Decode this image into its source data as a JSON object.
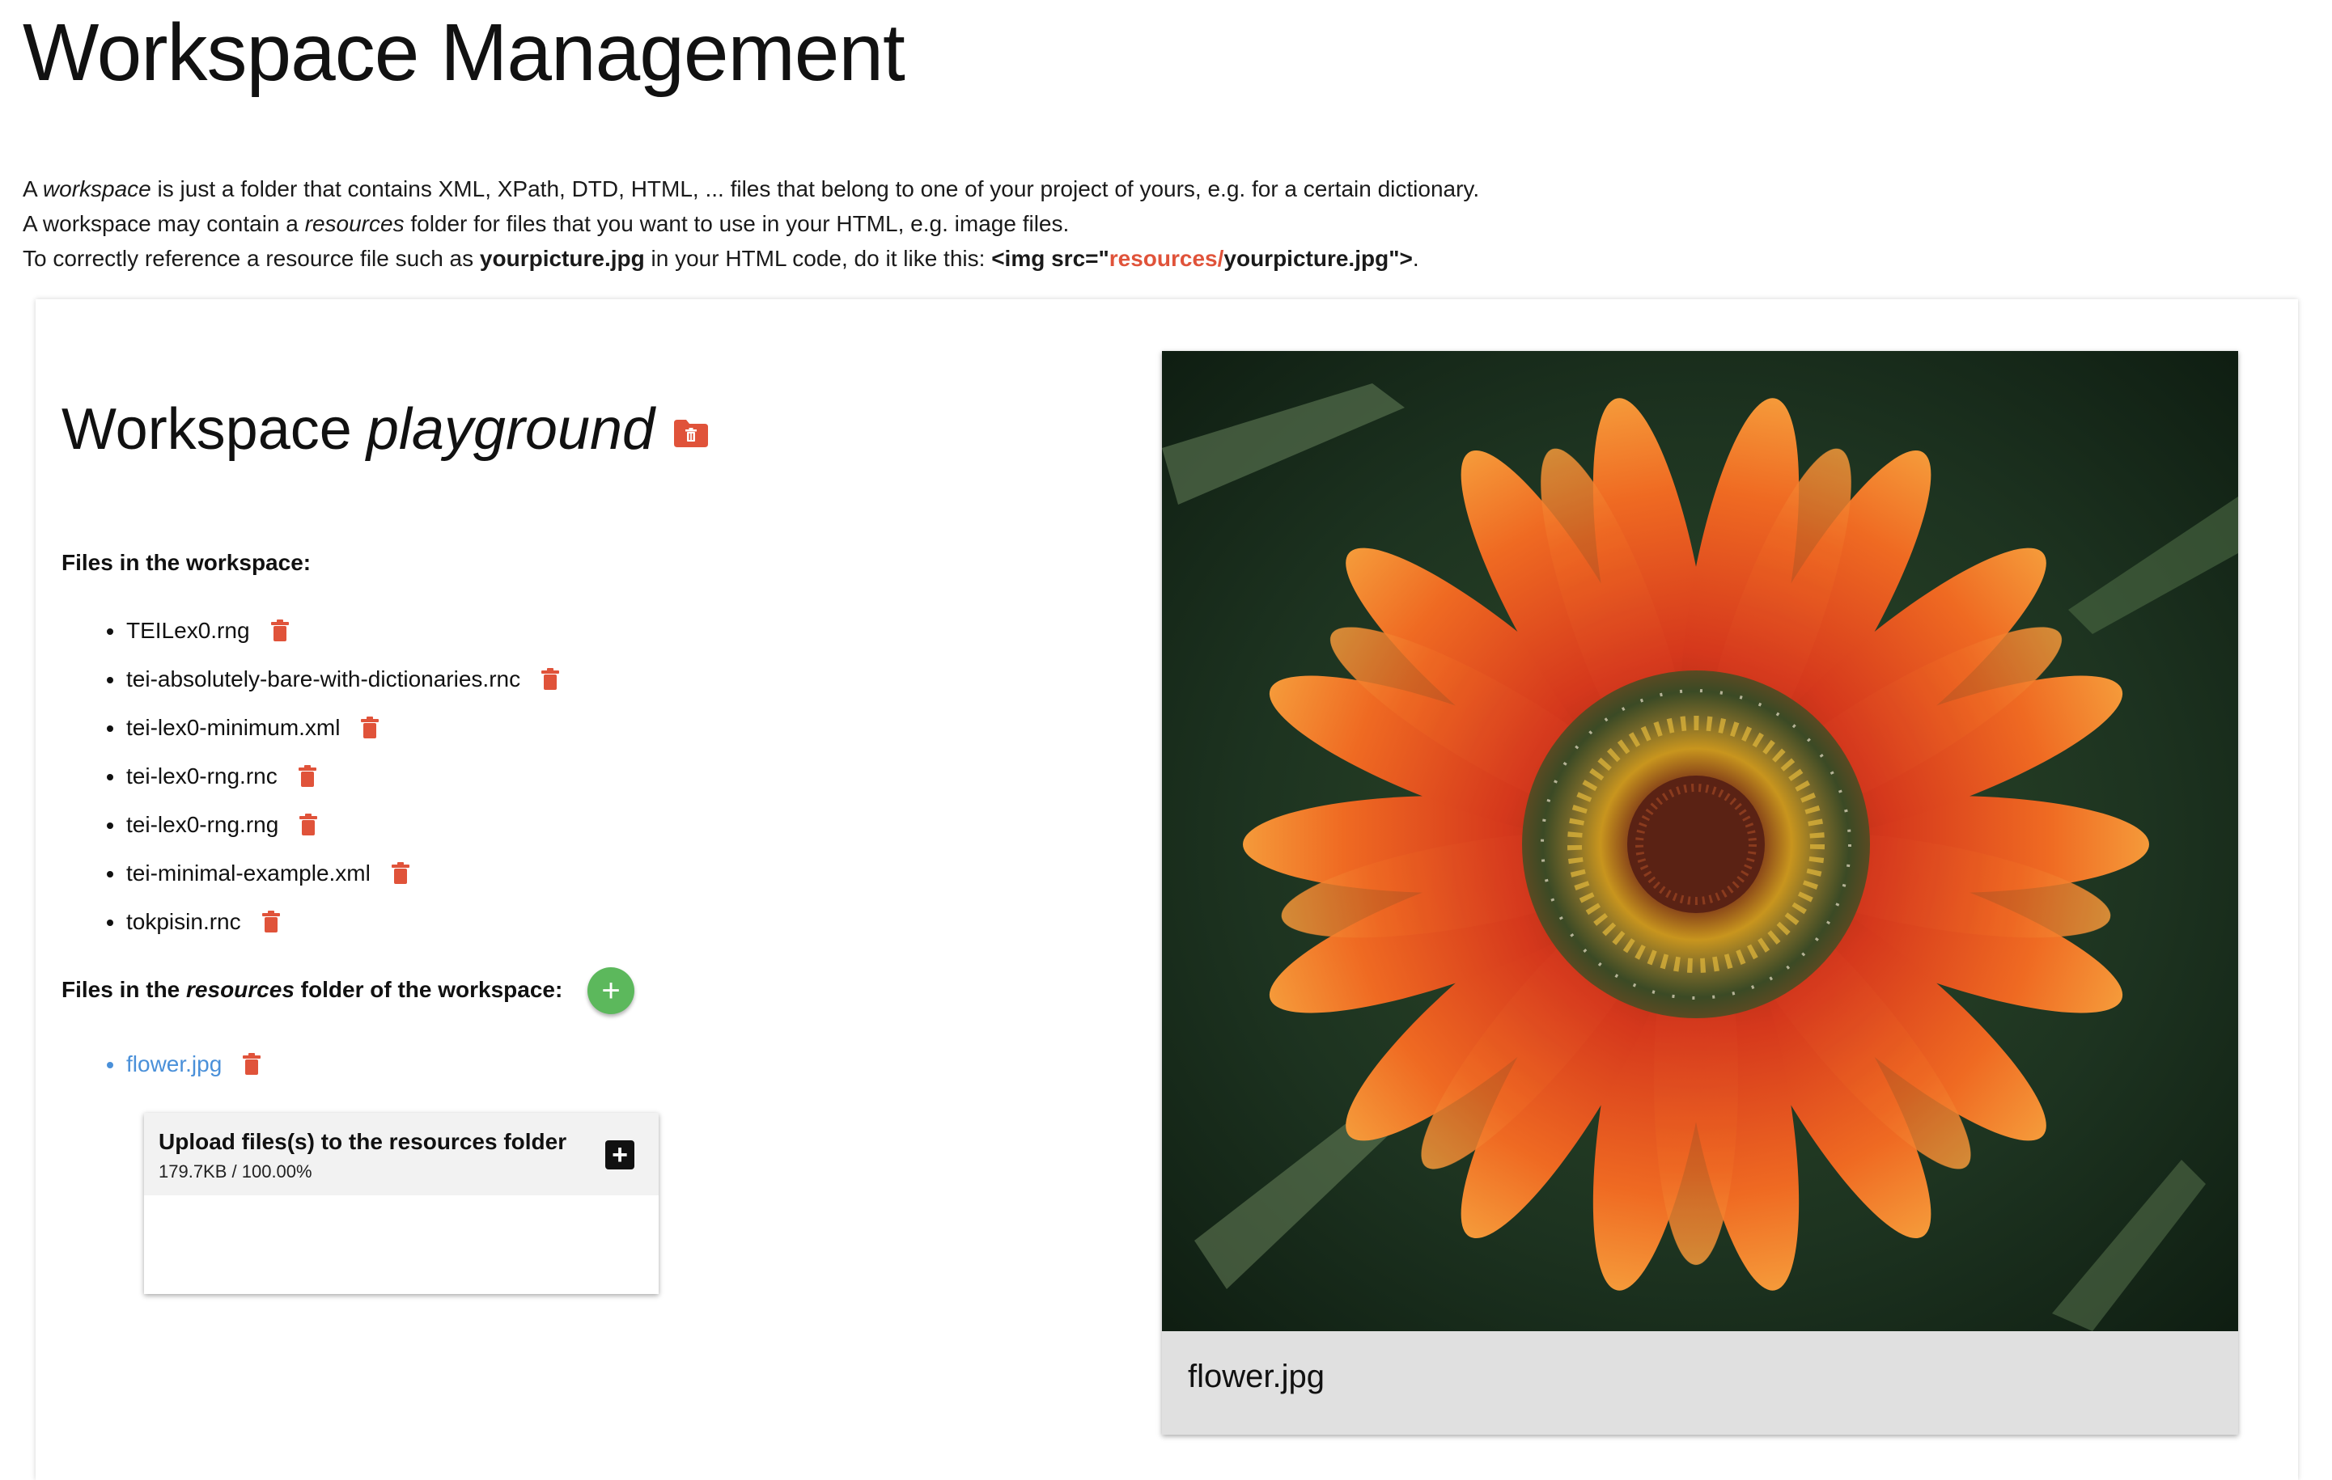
{
  "page": {
    "title": "Workspace Management"
  },
  "intro": {
    "line1": {
      "a": "A ",
      "em": "workspace",
      "b": " is just a folder that contains XML, XPath, DTD, HTML, ... files that belong to one of your project of yours, e.g. for a certain dictionary."
    },
    "line2": {
      "a": "A workspace may contain a ",
      "em": "resources",
      "b": " folder for files that you want to use in your HTML, e.g. image files."
    },
    "line3": {
      "a": "To correctly reference a resource file such as ",
      "file": "yourpicture.jpg",
      "b": " in your HTML code, do it like this: ",
      "code_start": "<img src=\"",
      "code_folder": "resources/",
      "code_end": "yourpicture.jpg\">",
      "period": "."
    }
  },
  "workspace": {
    "title_prefix": "Workspace",
    "name": "playground",
    "files_label": "Files in the workspace:",
    "files": [
      "TEILex0.rng",
      "tei-absolutely-bare-with-dictionaries.rnc",
      "tei-lex0-minimum.xml",
      "tei-lex0-rng.rnc",
      "tei-lex0-rng.rng",
      "tei-minimal-example.xml",
      "tokpisin.rnc"
    ],
    "resources_label": {
      "a": "Files in the ",
      "em": "resources",
      "b": " folder of the workspace:"
    },
    "resources": [
      "flower.jpg"
    ],
    "add_icon": "+"
  },
  "upload": {
    "title": "Upload files(s) to the resources folder",
    "progress": "179.7KB / 100.00%",
    "add_icon": "+"
  },
  "preview": {
    "caption": "flower.jpg"
  },
  "colors": {
    "accent_red": "#e0533a",
    "link_blue": "#4a90d9",
    "add_green": "#5cb85c"
  }
}
